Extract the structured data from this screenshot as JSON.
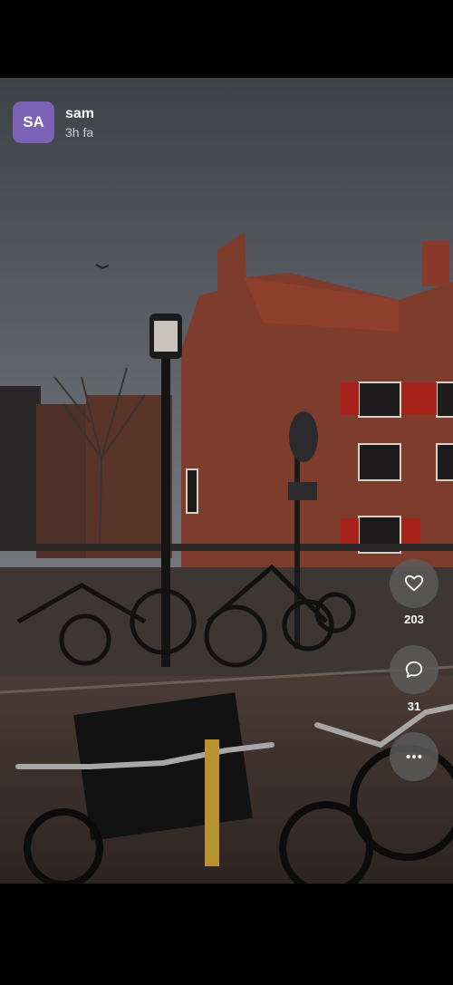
{
  "post": {
    "author": {
      "initials": "SA",
      "name": "sam",
      "time": "3h fa",
      "avatar_color": "#7c62b5"
    }
  },
  "actions": {
    "like": {
      "icon": "heart-icon",
      "count": "203"
    },
    "comment": {
      "icon": "comment-bubble-icon",
      "count": "31"
    },
    "more": {
      "icon": "more-dots-icon"
    }
  }
}
